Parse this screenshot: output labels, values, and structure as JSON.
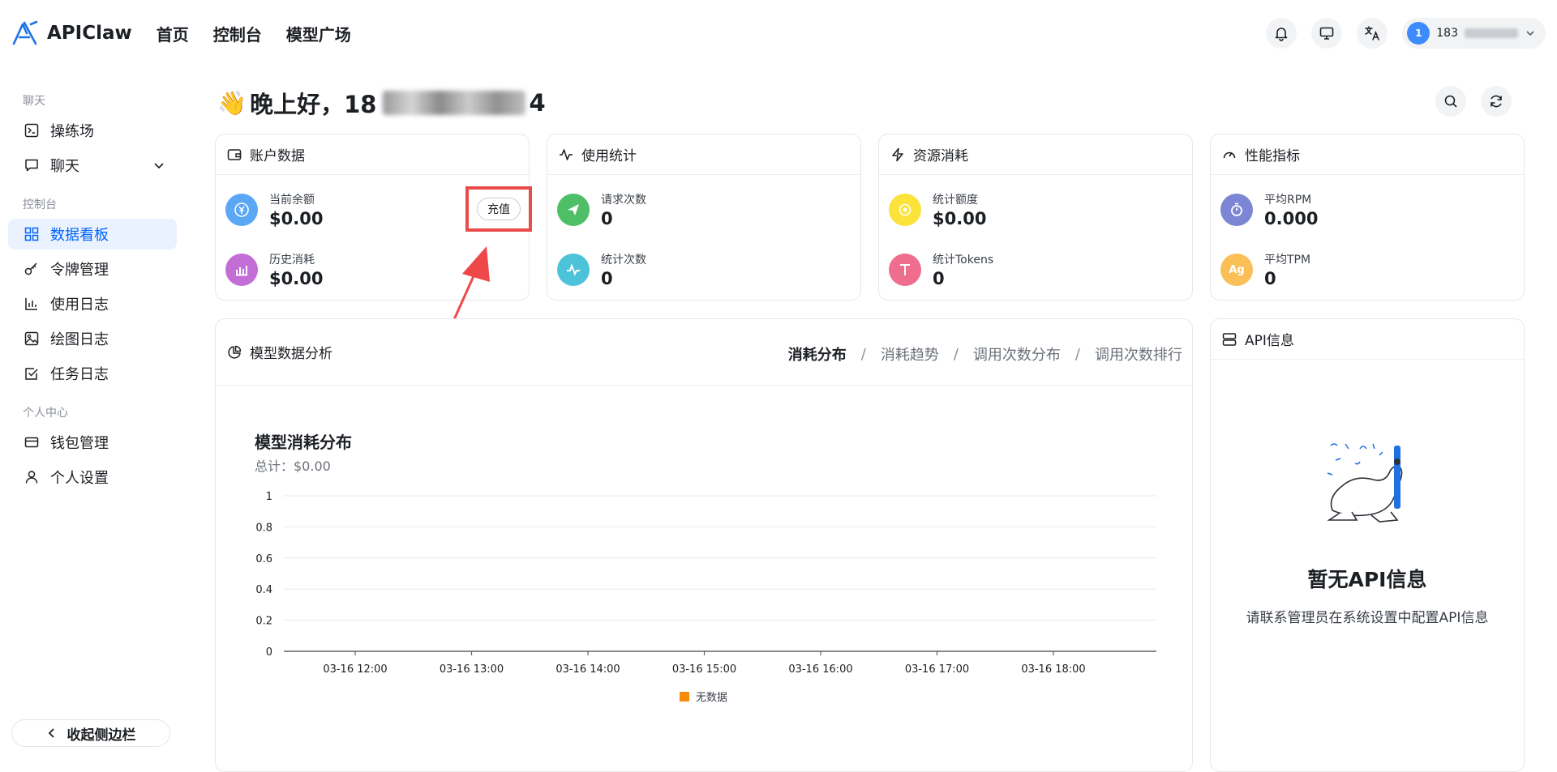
{
  "app": {
    "name": "APIClaw"
  },
  "topnav": [
    "首页",
    "控制台",
    "模型广场"
  ],
  "user": {
    "avatar_letter": "1",
    "name_prefix": "183"
  },
  "sidebar": {
    "sections": [
      {
        "title": "聊天",
        "items": [
          {
            "label": "操练场",
            "icon": "playground-icon"
          },
          {
            "label": "聊天",
            "icon": "chat-icon"
          }
        ]
      },
      {
        "title": "控制台",
        "items": [
          {
            "label": "数据看板",
            "icon": "dashboard-icon"
          },
          {
            "label": "令牌管理",
            "icon": "key-icon"
          },
          {
            "label": "使用日志",
            "icon": "bar-chart-icon"
          },
          {
            "label": "绘图日志",
            "icon": "image-icon"
          },
          {
            "label": "任务日志",
            "icon": "checkbox-icon"
          }
        ]
      },
      {
        "title": "个人中心",
        "items": [
          {
            "label": "钱包管理",
            "icon": "wallet-icon"
          },
          {
            "label": "个人设置",
            "icon": "user-icon"
          }
        ]
      }
    ],
    "collapse_label": "收起侧边栏"
  },
  "greeting": {
    "emoji": "👋",
    "text": "晚上好，18",
    "suffix": "4"
  },
  "cards": {
    "account": {
      "title": "账户数据",
      "balance_label": "当前余额",
      "balance_value": "$0.00",
      "recharge_label": "充值",
      "history_label": "历史消耗",
      "history_value": "$0.00"
    },
    "usage": {
      "title": "使用统计",
      "requests_label": "请求次数",
      "requests_value": "0",
      "count_label": "统计次数",
      "count_value": "0"
    },
    "resource": {
      "title": "资源消耗",
      "quota_label": "统计额度",
      "quota_value": "$0.00",
      "tokens_label": "统计Tokens",
      "tokens_value": "0"
    },
    "performance": {
      "title": "性能指标",
      "rpm_label": "平均RPM",
      "rpm_value": "0.000",
      "tpm_label": "平均TPM",
      "tpm_value": "0"
    }
  },
  "analysis": {
    "title": "模型数据分析",
    "tabs": [
      "消耗分布",
      "消耗趋势",
      "调用次数分布",
      "调用次数排行"
    ],
    "active_tab": 0
  },
  "chart_data": {
    "type": "bar",
    "title": "模型消耗分布",
    "subtitle": "总计：$0.00",
    "categories": [
      "03-16 12:00",
      "03-16 13:00",
      "03-16 14:00",
      "03-16 15:00",
      "03-16 16:00",
      "03-16 17:00",
      "03-16 18:00"
    ],
    "series": [
      {
        "name": "无数据",
        "values": [
          0,
          0,
          0,
          0,
          0,
          0,
          0
        ],
        "color": "#f58a0b"
      }
    ],
    "yticks": [
      "1",
      "0.8",
      "0.6",
      "0.4",
      "0.2",
      "0"
    ],
    "ylim": [
      0,
      1
    ],
    "grid": true,
    "legend": "bottom"
  },
  "api_info": {
    "title": "API信息",
    "empty_title": "暂无API信息",
    "empty_desc": "请联系管理员在系统设置中配置API信息"
  },
  "colors": {
    "accent": "#0064fa",
    "highlight": "#e94a4a"
  }
}
